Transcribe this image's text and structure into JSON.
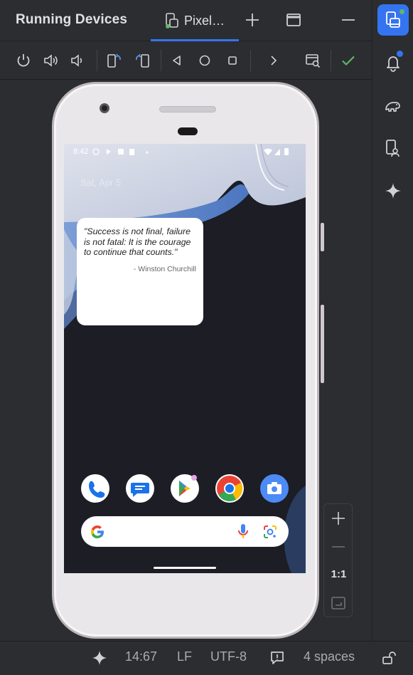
{
  "header": {
    "title": "Running Devices",
    "tab_label": "Pixel…"
  },
  "phone": {
    "status_time": "8:42",
    "date": "Sat, Apr 5",
    "widget": {
      "quote": "\"Success is not final, failure is not fatal: It is the courage to continue that counts.\"",
      "author": "- Winston Churchill"
    },
    "dock_apps": [
      "phone-icon",
      "messages-icon",
      "play-store-icon",
      "chrome-icon",
      "camera-icon"
    ]
  },
  "zoom": {
    "actual_size_label": "1:1"
  },
  "statusbar": {
    "position": "14:67",
    "line_ending": "LF",
    "encoding": "UTF-8",
    "indent": "4 spaces"
  },
  "colors": {
    "accent": "#3574f0",
    "check": "#5fb865",
    "notification_dot": "#3574f0",
    "online_dot": "#5fb865"
  }
}
